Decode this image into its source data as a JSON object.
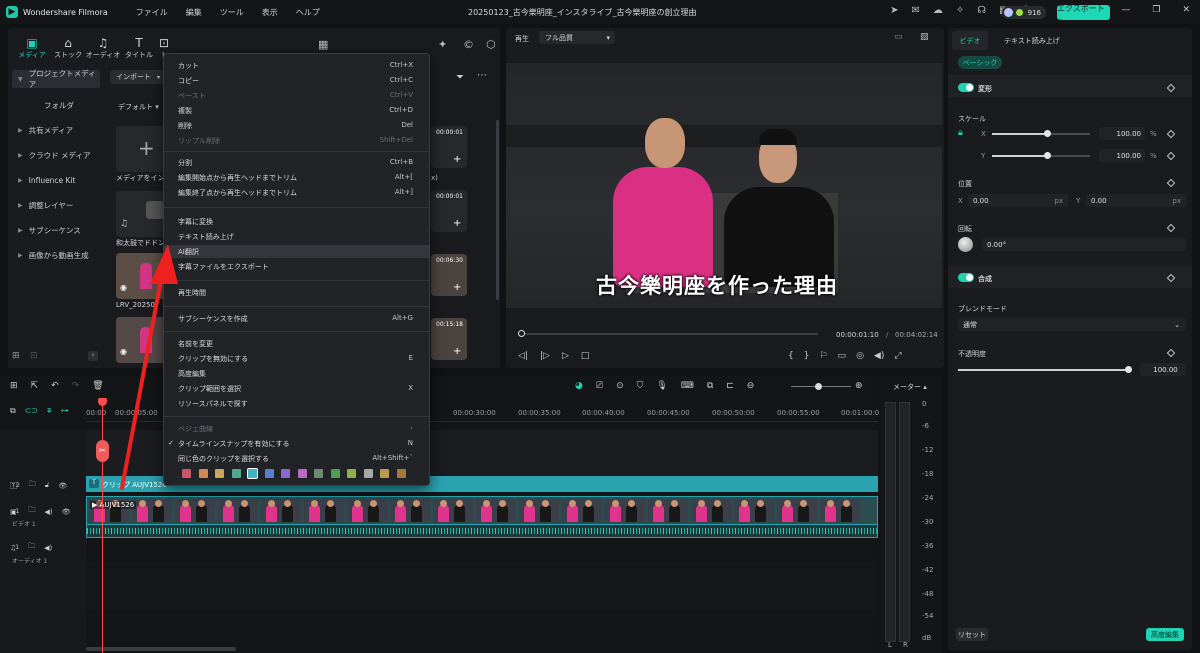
{
  "app": {
    "name": "Wondershare Filmora",
    "doc_title": "20250123_古今樂明座_インスタライブ_古今樂明座の創立理由",
    "credits": "916",
    "export_label": "エクスポート ⌄"
  },
  "menu": [
    "ファイル",
    "編集",
    "ツール",
    "表示",
    "ヘルプ"
  ],
  "tools": [
    {
      "label": "メディア",
      "icon": "▣"
    },
    {
      "label": "ストック",
      "icon": "⌂"
    },
    {
      "label": "オーディオ",
      "icon": "♫"
    },
    {
      "label": "タイトル",
      "icon": "T"
    },
    {
      "label": "ト",
      "icon": "⊡"
    }
  ],
  "extra_tool_icons": [
    "✦",
    "©",
    "⬡",
    "▦"
  ],
  "sidebar": {
    "project_media": "プロジェクトメディア",
    "folder": "フォルダ",
    "items": [
      "共有メディア",
      "クラウド メディア",
      "Influence Kit",
      "調整レイヤー",
      "サブシーケンス",
      "画像から動画生成"
    ]
  },
  "media": {
    "import": "インポート",
    "sort": "デフォルト",
    "import_media": "メディアをインポ",
    "track_name": "和太鼓でドドン",
    "clip_name": "LRV_20250",
    "durations": [
      "00:00:01",
      "00:00:01",
      "00:06:30",
      "00:15:18"
    ],
    "partial_label": "x)"
  },
  "preview": {
    "play_label": "再生",
    "quality": "フル品質",
    "subtitle": "古今樂明座を作った理由",
    "current_time": "00:00:01:10",
    "total_time": "00:04:02:14",
    "slash": "/"
  },
  "context_menu": {
    "items": [
      {
        "label": "カット",
        "shortcut": "Ctrl+X",
        "disabled": false
      },
      {
        "label": "コピー",
        "shortcut": "Ctrl+C",
        "disabled": false
      },
      {
        "label": "ペースト",
        "shortcut": "Ctrl+V",
        "disabled": true
      },
      {
        "label": "複製",
        "shortcut": "Ctrl+D",
        "disabled": false
      },
      {
        "label": "削除",
        "shortcut": "Del",
        "disabled": false
      },
      {
        "label": "リップル削除",
        "shortcut": "Shift+Del",
        "disabled": true
      },
      {
        "label": "分割",
        "shortcut": "Ctrl+B",
        "disabled": false
      },
      {
        "label": "編集開始点から再生ヘッドまでトリム",
        "shortcut": "Alt+[",
        "disabled": false
      },
      {
        "label": "編集終了点から再生ヘッドまでトリム",
        "shortcut": "Alt+]",
        "disabled": false
      },
      {
        "label": "字幕に変換",
        "shortcut": "",
        "disabled": false
      },
      {
        "label": "テキスト読み上げ",
        "shortcut": "",
        "disabled": false
      },
      {
        "label": "AI翻訳",
        "shortcut": "",
        "disabled": false
      },
      {
        "label": "字幕ファイルをエクスポート",
        "shortcut": "",
        "disabled": false
      },
      {
        "label": "再生時間",
        "shortcut": "",
        "disabled": false
      },
      {
        "label": "サブシーケンスを作成",
        "shortcut": "Alt+G",
        "disabled": false
      },
      {
        "label": "名前を変更",
        "shortcut": "",
        "disabled": false
      },
      {
        "label": "クリップを無効にする",
        "shortcut": "E",
        "disabled": false
      },
      {
        "label": "高度編集",
        "shortcut": "",
        "disabled": false
      },
      {
        "label": "クリップ範囲を選択",
        "shortcut": "X",
        "disabled": false
      },
      {
        "label": "リソースパネルで探す",
        "shortcut": "",
        "disabled": false
      },
      {
        "label": "ベジェ曲線",
        "shortcut": "›",
        "disabled": true
      },
      {
        "label": "タイムラインスナップを有効にする",
        "shortcut": "N",
        "disabled": false
      },
      {
        "label": "同じ色のクリップを選択する",
        "shortcut": "Alt+Shift+`",
        "disabled": false
      }
    ],
    "check_mark": "✓",
    "swatches": [
      "#c7586a",
      "#cf8a59",
      "#c9a75a",
      "#4fa88f",
      "#3fb3c4",
      "#5a7fd0",
      "#8b67cf",
      "#b76ac6",
      "#6f8b74",
      "#4f9c55",
      "#8fb04c",
      "#a7a7a7",
      "#b89a50",
      "#a57a3c"
    ]
  },
  "timeline": {
    "ruler": [
      "00:00",
      "00:00:05:00",
      "00:00:30:00",
      "00:00:35:00",
      "00:00:40:00",
      "00:00:45:00",
      "00:00:50:00",
      "00:00:55:00",
      "00:01:00:00"
    ],
    "clip_title": "クリップ AUJV1526",
    "clip_video": "AUJV1526",
    "video_track": "ビデオ 1",
    "audio_track": "オーディオ 1",
    "track2": "2",
    "track1": "1",
    "audio_num": "1",
    "meter_label": "メーター ▴",
    "meter_scale": [
      "0",
      "-6",
      "-12",
      "-18",
      "-24",
      "-30",
      "-36",
      "-42",
      "-48",
      "-54",
      "dB"
    ],
    "meter_lr": [
      "L",
      "R"
    ]
  },
  "props": {
    "tabs": [
      "ビデオ",
      "テキスト読み上げ"
    ],
    "basic": "ベーシック",
    "transform": "変形",
    "scale": "スケール",
    "x": "X",
    "y": "Y",
    "scale_x": "100.00",
    "scale_y": "100.00",
    "percent": "%",
    "position": "位置",
    "pos_x": "0.00",
    "pos_y": "0.00",
    "px": "px",
    "rotation": "回転",
    "rotation_value": "0.00°",
    "composite": "合成",
    "blend_mode": "ブレンドモード",
    "blend_value": "通常",
    "opacity": "不透明度",
    "opacity_value": "100.00",
    "reset": "リセット",
    "advanced": "高度編集",
    "scale_x_level": 0.56,
    "scale_y_level": 0.56,
    "opacity_level": 1.0
  },
  "colors": {
    "accent": "#1fd3b3",
    "playhead": "#ff4b4b",
    "clip_teal": "#2aa2b0",
    "arrow": "#ee2020"
  }
}
